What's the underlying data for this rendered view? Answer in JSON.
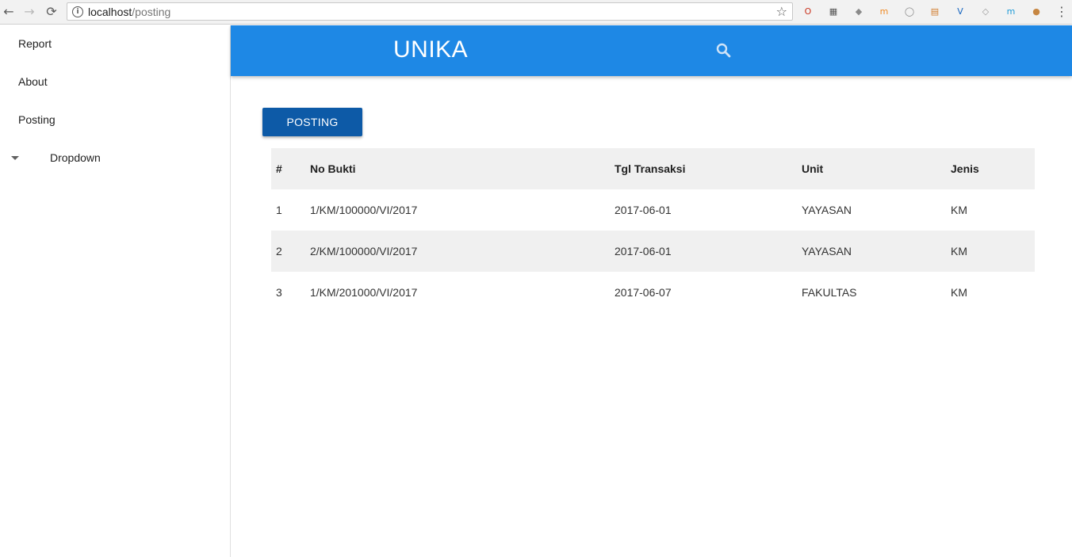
{
  "browser": {
    "back_icon": "←",
    "forward_icon": "→",
    "reload_icon": "⟳",
    "url_host": "localhost",
    "url_path": "/posting",
    "star_icon": "☆",
    "menu_icon": "⋮",
    "extensions": [
      {
        "name": "opera-icon",
        "glyph": "O",
        "color": "#c9331e"
      },
      {
        "name": "qr-icon",
        "glyph": "▦",
        "color": "#555555"
      },
      {
        "name": "cube-icon",
        "glyph": "◆",
        "color": "#8a8a8a"
      },
      {
        "name": "m-orange-icon",
        "glyph": "m",
        "color": "#f08a24"
      },
      {
        "name": "circle-icon",
        "glyph": "◯",
        "color": "#888888"
      },
      {
        "name": "note-icon",
        "glyph": "▤",
        "color": "#d07a2a"
      },
      {
        "name": "v-icon",
        "glyph": "V",
        "color": "#1565c0"
      },
      {
        "name": "diamond-icon",
        "glyph": "◇",
        "color": "#999999"
      },
      {
        "name": "m-circle-icon",
        "glyph": "m",
        "color": "#1e9bd7"
      },
      {
        "name": "cookie-icon",
        "glyph": "●",
        "color": "#c68642"
      }
    ]
  },
  "sidebar": {
    "items": [
      {
        "label": "Report"
      },
      {
        "label": "About"
      },
      {
        "label": "Posting"
      },
      {
        "label": "Dropdown"
      }
    ]
  },
  "appbar": {
    "title": "UNIKA",
    "color": "#1e88e5"
  },
  "main": {
    "posting_button": "POSTING",
    "table": {
      "headers": [
        "#",
        "No Bukti",
        "Tgl Transaksi",
        "Unit",
        "Jenis"
      ],
      "rows": [
        [
          "1",
          "1/KM/100000/VI/2017",
          "2017-06-01",
          "YAYASAN",
          "KM"
        ],
        [
          "2",
          "2/KM/100000/VI/2017",
          "2017-06-01",
          "YAYASAN",
          "KM"
        ],
        [
          "3",
          "1/KM/201000/VI/2017",
          "2017-06-07",
          "FAKULTAS",
          "KM"
        ]
      ]
    }
  }
}
